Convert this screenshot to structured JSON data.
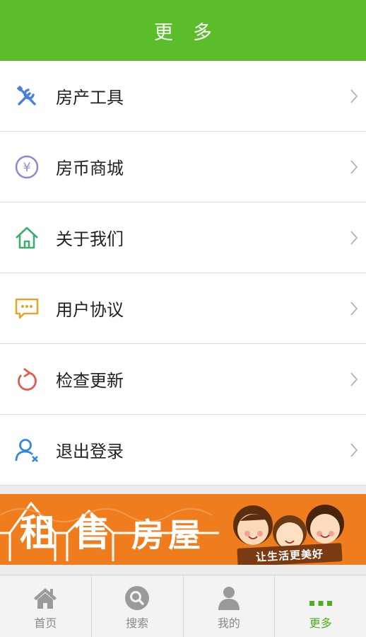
{
  "header": {
    "title": "更多"
  },
  "menu": {
    "items": [
      {
        "label": "房产工具",
        "icon": "tools-icon",
        "color": "#4a7fe0"
      },
      {
        "label": "房币商城",
        "icon": "yuan-coin-icon",
        "color": "#8f86d8"
      },
      {
        "label": "关于我们",
        "icon": "home-icon",
        "color": "#3cae72"
      },
      {
        "label": "用户协议",
        "icon": "chat-bubble-icon",
        "color": "#e0a52f"
      },
      {
        "label": "检查更新",
        "icon": "refresh-icon",
        "color": "#e25b4f"
      },
      {
        "label": "退出登录",
        "icon": "user-remove-icon",
        "color": "#2f86e6"
      }
    ]
  },
  "banner": {
    "char1": "租",
    "char2": "售",
    "text": "房屋",
    "slogan": "让生活更美好"
  },
  "tabbar": {
    "tabs": [
      {
        "label": "首页",
        "icon": "home-tab-icon"
      },
      {
        "label": "搜索",
        "icon": "search-tab-icon"
      },
      {
        "label": "我的",
        "icon": "user-tab-icon"
      },
      {
        "label": "更多",
        "icon": "more-dots-icon",
        "active": true
      }
    ],
    "active_color": "#4fae1f",
    "inactive_color": "#8a8a8a"
  },
  "theme": {
    "header_bg": "#5bbd2a",
    "banner_bg": "#ef7c1d"
  }
}
